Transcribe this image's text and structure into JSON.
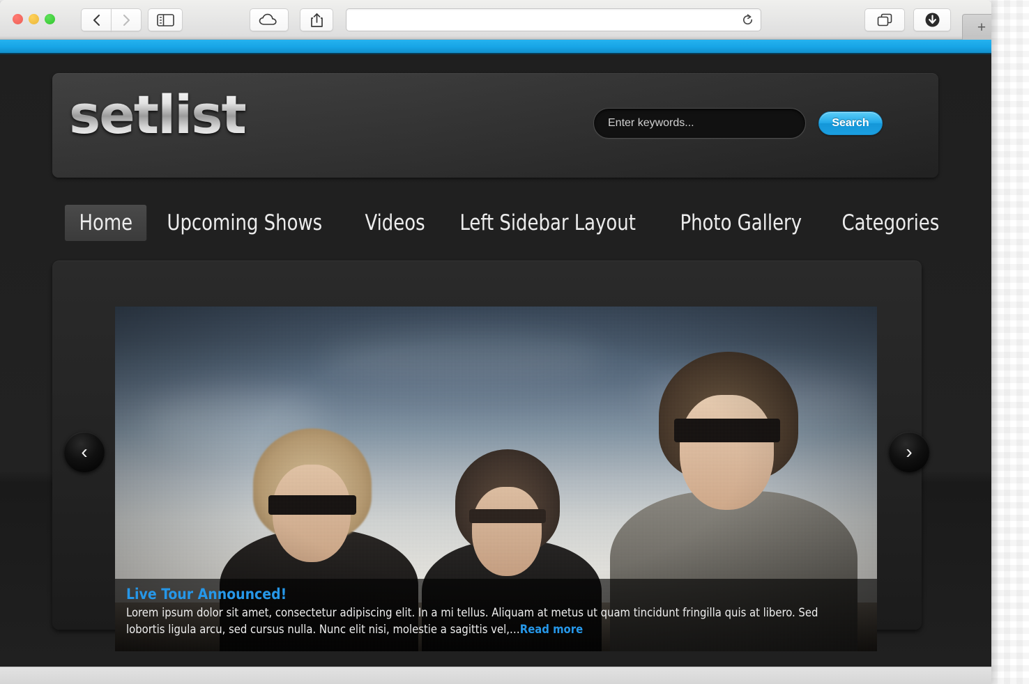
{
  "browser": {
    "traffic_lights": [
      {
        "name": "close",
        "color": "#ec5f55"
      },
      {
        "name": "minimize",
        "color": "#e9b63b"
      },
      {
        "name": "zoom",
        "color": "#2fc62c"
      }
    ],
    "toolbar_buttons": [
      {
        "name": "back",
        "icon": "chevron-left-icon",
        "enabled": true
      },
      {
        "name": "forward",
        "icon": "chevron-right-icon",
        "enabled": false
      },
      {
        "name": "sidebar",
        "icon": "sidebar-icon",
        "enabled": true
      },
      {
        "name": "icloud-tabs",
        "icon": "cloud-icon",
        "enabled": true
      },
      {
        "name": "share",
        "icon": "share-icon",
        "enabled": true
      },
      {
        "name": "show-tabs",
        "icon": "tabs-overview-icon",
        "enabled": true
      },
      {
        "name": "downloads",
        "icon": "download-icon",
        "enabled": true
      }
    ],
    "address_bar": {
      "value": "",
      "placeholder": "",
      "reload_icon": "reload-icon"
    },
    "new_tab_label": "+"
  },
  "site": {
    "accent_color": "#1BA7E8",
    "logo_text": "setlist",
    "search": {
      "placeholder": "Enter keywords...",
      "value": "",
      "button_label": "Search"
    },
    "nav": {
      "items": [
        {
          "label": "Home",
          "active": true
        },
        {
          "label": "Upcoming Shows",
          "active": false
        },
        {
          "label": "Videos",
          "active": false
        },
        {
          "label": "Left Sidebar Layout",
          "active": false
        },
        {
          "label": "Photo Gallery",
          "active": false
        },
        {
          "label": "Categories",
          "active": false
        }
      ]
    },
    "slider": {
      "prev_label": "‹",
      "next_label": "›",
      "slide": {
        "title": "Live Tour Announced!",
        "body": "Lorem ipsum dolor sit amet, consectetur adipiscing elit. In a mi tellus. Aliquam at metus ut quam tincidunt fringilla quis at libero. Sed lobortis ligula arcu, sed cursus nulla. Nunc elit nisi, molestie a sagittis vel,…",
        "read_more_label": "Read more",
        "image_alt": "three band members in sunglasses against a bright sky"
      }
    }
  }
}
